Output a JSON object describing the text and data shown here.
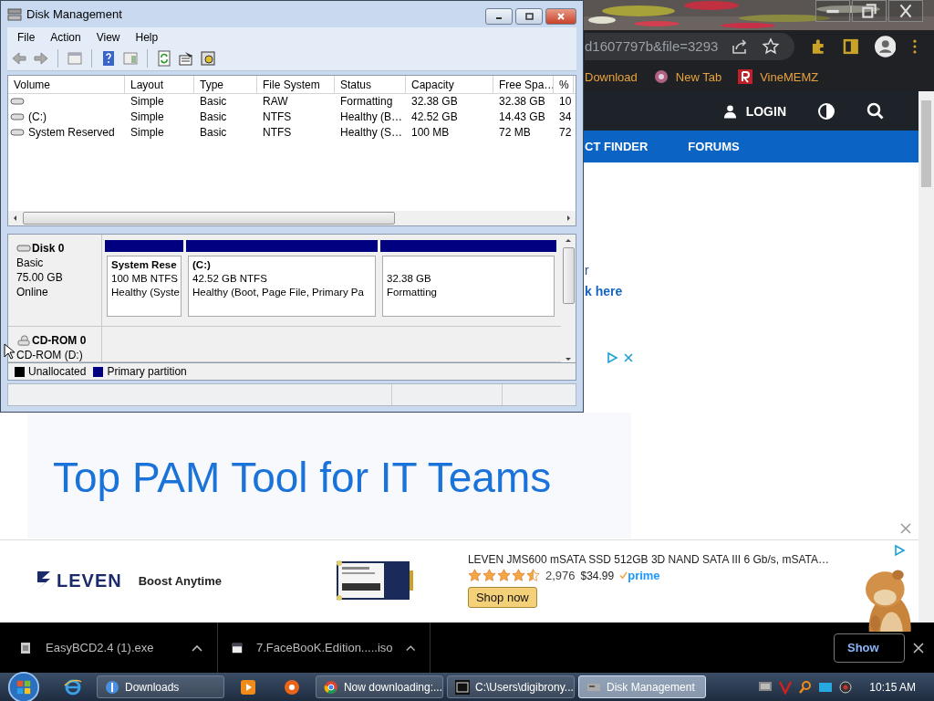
{
  "disk_management": {
    "title": "Disk Management",
    "menu": [
      "File",
      "Action",
      "View",
      "Help"
    ],
    "columns": [
      "Volume",
      "Layout",
      "Type",
      "File System",
      "Status",
      "Capacity",
      "Free Spa…",
      "%"
    ],
    "rows": [
      {
        "values": [
          "Simple",
          "Basic",
          "RAW",
          "Formatting",
          "32.38 GB",
          "32.38 GB",
          "10"
        ]
      },
      {
        "volume": "(C:)",
        "values": [
          "Simple",
          "Basic",
          "NTFS",
          "Healthy (B…",
          "42.52 GB",
          "14.43 GB",
          "34"
        ]
      },
      {
        "volume": "System Reserved",
        "values": [
          "Simple",
          "Basic",
          "NTFS",
          "Healthy (S…",
          "100 MB",
          "72 MB",
          "72"
        ]
      }
    ],
    "disks": [
      {
        "kind": "disk",
        "name": "Disk 0",
        "lines": [
          "Basic",
          "75.00 GB",
          "Online"
        ],
        "partitions": [
          {
            "name": "System Rese",
            "size": "100 MB NTFS",
            "status": "Healthy (Syste"
          },
          {
            "name": "(C:)",
            "size": "42.52 GB NTFS",
            "status": "Healthy (Boot, Page File, Primary Pa"
          },
          {
            "size": "32.38 GB",
            "status": "Formatting"
          }
        ]
      },
      {
        "kind": "cdrom",
        "name": "CD-ROM 0",
        "lines": [
          "CD-ROM (D:)"
        ]
      }
    ],
    "legend": [
      {
        "label": "Unallocated",
        "color": "#000000"
      },
      {
        "label": "Primary partition",
        "color": "#000080"
      }
    ]
  },
  "browser": {
    "address": "d1607797b&file=3293",
    "bookmarks": [
      "Download",
      "New Tab",
      "VineMEMZ"
    ],
    "login": "LOGIN",
    "nav": [
      "CT FINDER",
      "FORUMS"
    ],
    "fragments": [
      "r",
      "k here"
    ],
    "ad": {
      "headline": "Top PAM Tool for IT Teams"
    },
    "banner": {
      "logo": "LEVEN",
      "slogan": "Boost Anytime",
      "title": "LEVEN JMS600 mSATA SSD 512GB 3D NAND SATA III 6 Gb/s, mSATA…",
      "stars": 4.5,
      "reviews": "2,976",
      "price": "$34.99",
      "prime": "prime",
      "button": "Shop now"
    }
  },
  "downloads": {
    "items": [
      "EasyBCD2.4 (1).exe",
      "7.FaceBooK.Edition.....iso"
    ],
    "show_all": "Show"
  },
  "taskbar": {
    "buttons": [
      {
        "label": "Downloads",
        "selected": false
      },
      {
        "label": "Now downloading:...",
        "selected": false
      },
      {
        "label": "C:\\Users\\digibrony...",
        "selected": false
      },
      {
        "label": "Disk Management",
        "selected": true
      }
    ],
    "clock": "10:15 AM"
  }
}
